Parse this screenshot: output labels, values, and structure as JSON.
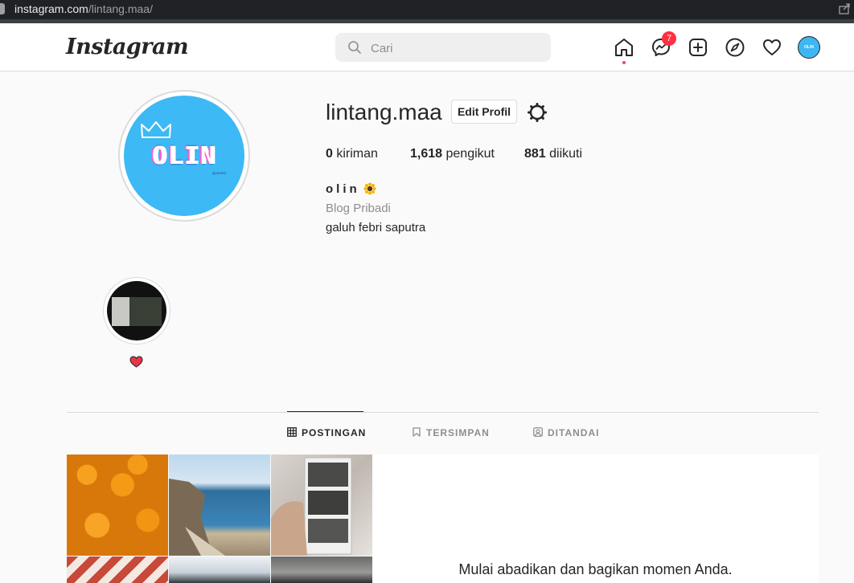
{
  "browser": {
    "url_host": "instagram.com",
    "url_path": "/lintang.maa/"
  },
  "nav": {
    "logo": "Instagram",
    "search_placeholder": "Cari",
    "messenger_badge": "7",
    "icons": [
      "home-icon",
      "messenger-icon",
      "new-post-icon",
      "explore-icon",
      "activity-heart-icon",
      "avatar"
    ]
  },
  "profile": {
    "username": "lintang.maa",
    "edit_label": "Edit Profil",
    "avatar_text": "OLIN",
    "avatar_subtext": "QUOTES",
    "stats": [
      {
        "value": "0",
        "label": " kiriman"
      },
      {
        "value": "1,618",
        "label": " pengikut"
      },
      {
        "value": "881",
        "label": " diikuti"
      }
    ],
    "full_name": "olin",
    "category": "Blog Pribadi",
    "bio": "galuh febri saputra"
  },
  "highlight": {
    "title_emoji": "heart"
  },
  "tabs": [
    {
      "label": "POSTINGAN",
      "icon": "grid-icon",
      "active": true
    },
    {
      "label": "TERSIMPAN",
      "icon": "bookmark-icon",
      "active": false
    },
    {
      "label": "DITANDAI",
      "icon": "tagged-icon",
      "active": false
    }
  ],
  "promo": {
    "text": "Mulai abadikan dan bagikan momen Anda."
  },
  "colors": {
    "accent_blue": "#3db9f5",
    "badge_red": "#ff3040",
    "text": "#262626",
    "muted": "#8e8e8e"
  }
}
